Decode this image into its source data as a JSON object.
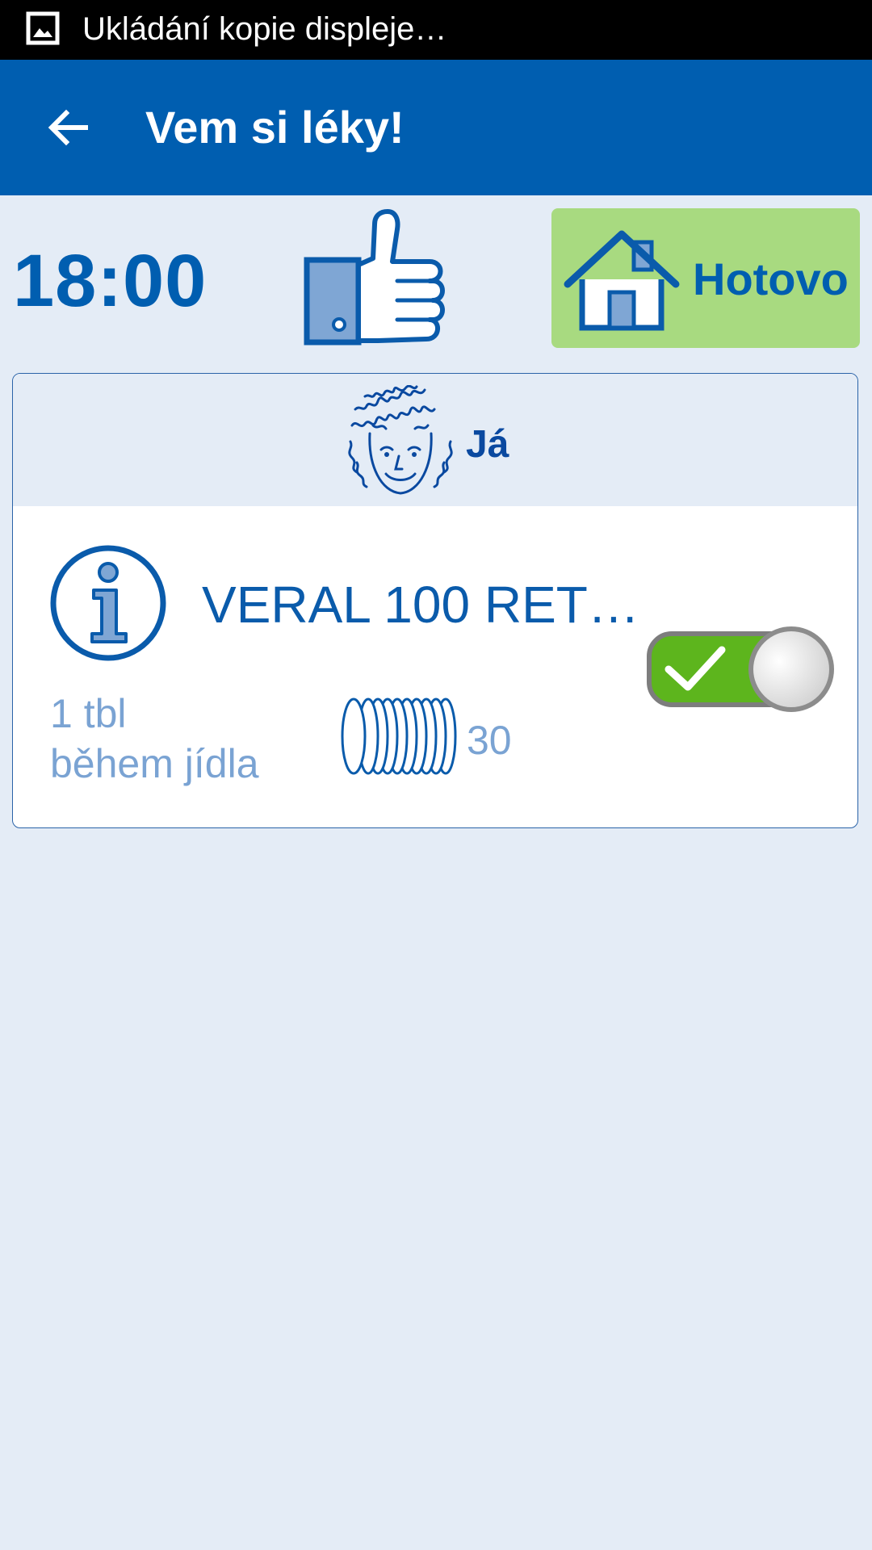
{
  "status_bar": {
    "icon": "screenshot-image-icon",
    "text": "Ukládání kopie displeje…"
  },
  "app_bar": {
    "back_icon": "arrow-left-icon",
    "title": "Vem si léky!"
  },
  "toolbar": {
    "time": "18:00",
    "thumb_icon": "thumbs-up-icon",
    "done_button": {
      "icon": "house-icon",
      "label": "Hotovo",
      "background": "#a8da80"
    }
  },
  "card": {
    "person": {
      "icon": "curly-hair-face-icon",
      "name": "Já"
    },
    "medication": {
      "info_icon": "info-circle-icon",
      "name": "VERAL 100 RET…",
      "dose_line1": "1 tbl",
      "dose_line2": "během jídla",
      "pills_icon": "pill-stack-icon",
      "remaining": "30",
      "taken_toggle": {
        "state": "on",
        "icon": "checkmark-icon",
        "on_color": "#5db51d"
      }
    }
  },
  "colors": {
    "primary": "#005eb0",
    "background": "#e4ecf6",
    "secondary_text": "#7aa3d3"
  }
}
